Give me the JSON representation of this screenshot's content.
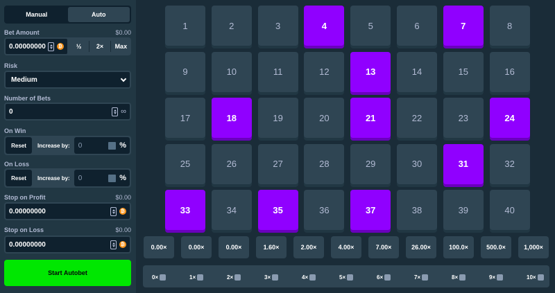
{
  "tabs": [
    "Manual",
    "Auto"
  ],
  "bet": {
    "label": "Bet Amount",
    "usd": "$0.00",
    "value": "0.00000000",
    "half": "½",
    "double": "2×",
    "max": "Max"
  },
  "risk": {
    "label": "Risk",
    "value": "Medium"
  },
  "number_of_bets": {
    "label": "Number of Bets",
    "value": "0"
  },
  "on_win": {
    "label": "On Win",
    "reset": "Reset",
    "increase": "Increase by:",
    "value": "0",
    "pct": "%"
  },
  "on_loss": {
    "label": "On Loss",
    "reset": "Reset",
    "increase": "Increase by:",
    "value": "0",
    "pct": "%"
  },
  "stop_profit": {
    "label": "Stop on Profit",
    "usd": "$0.00",
    "value": "0.00000000"
  },
  "stop_loss": {
    "label": "Stop on Loss",
    "usd": "$0.00",
    "value": "0.00000000"
  },
  "start_button": "Start Autobet",
  "tiles": [
    "1",
    "2",
    "3",
    "4",
    "5",
    "6",
    "7",
    "8",
    "9",
    "10",
    "11",
    "12",
    "13",
    "14",
    "15",
    "16",
    "17",
    "18",
    "19",
    "20",
    "21",
    "22",
    "23",
    "24",
    "25",
    "26",
    "27",
    "28",
    "29",
    "30",
    "31",
    "32",
    "33",
    "34",
    "35",
    "36",
    "37",
    "38",
    "39",
    "40"
  ],
  "selected_tiles": [
    4,
    7,
    13,
    18,
    21,
    24,
    31,
    33,
    35,
    37
  ],
  "multipliers": [
    "0.00×",
    "0.00×",
    "0.00×",
    "1.60×",
    "2.00×",
    "4.00×",
    "7.00×",
    "26.00×",
    "100.0×",
    "500.0×",
    "1,000×"
  ],
  "hits": [
    "0×",
    "1×",
    "2×",
    "3×",
    "4×",
    "5×",
    "6×",
    "7×",
    "8×",
    "9×",
    "10×"
  ],
  "colors": {
    "selected": "#9000ff",
    "tile": "#2f4553",
    "start": "#00e701",
    "bg": "#1a2c38"
  }
}
